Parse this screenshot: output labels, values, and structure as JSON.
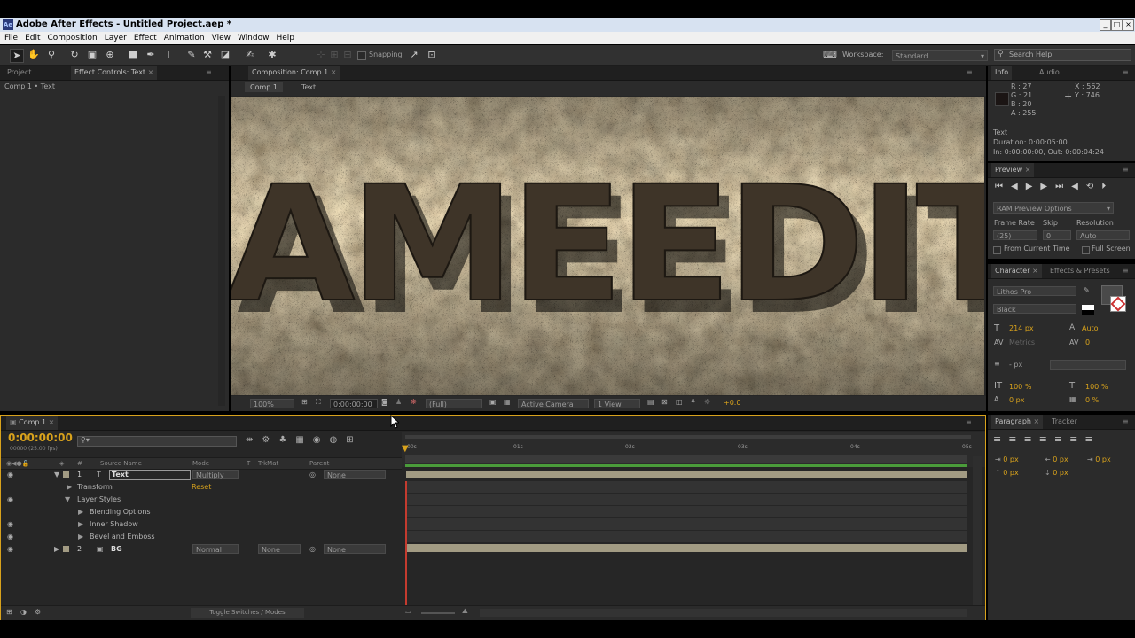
{
  "window": {
    "title": "Adobe After Effects - Untitled Project.aep *",
    "app_icon": "Ae",
    "min": "_",
    "max": "□",
    "close": "×"
  },
  "menu": [
    "File",
    "Edit",
    "Composition",
    "Layer",
    "Effect",
    "Animation",
    "View",
    "Window",
    "Help"
  ],
  "toolbar": {
    "snapping": "Snapping",
    "workspace_label": "Workspace:",
    "workspace_value": "Standard",
    "search_placeholder": "Search Help"
  },
  "project_panel": {
    "tab_project": "Project",
    "tab_effect_controls": "Effect Controls: Text",
    "breadcrumb": "Comp 1 • Text"
  },
  "composition": {
    "tab": "Composition: Comp 1",
    "breadcrumbs": [
      "Comp 1",
      "Text"
    ],
    "viewer_text": "AMEEDIT",
    "footer": {
      "zoom": "100%",
      "timecode": "0:00:00:00",
      "resolution": "(Full)",
      "camera": "Active Camera",
      "views": "1 View",
      "exposure": "+0.0"
    }
  },
  "info_panel": {
    "tabs": [
      "Info",
      "Audio"
    ],
    "r": "R : 27",
    "g": "G : 21",
    "b": "B : 20",
    "a": "A : 255",
    "x": "X : 562",
    "y": "Y : 746",
    "layer": "Text",
    "duration": "Duration: 0:00:05:00",
    "inout": "In: 0:00:00:00, Out: 0:00:04:24"
  },
  "preview_panel": {
    "tab": "Preview",
    "ram_options": "RAM Preview Options",
    "frame_rate_label": "Frame Rate",
    "skip_label": "Skip",
    "resolution_label": "Resolution",
    "frame_rate": "(25)",
    "skip": "0",
    "resolution": "Auto",
    "from_current": "From Current Time",
    "full_screen": "Full Screen"
  },
  "character_panel": {
    "tabs": [
      "Character",
      "Effects & Presets"
    ],
    "font": "Lithos Pro",
    "style": "Black",
    "size": "214 px",
    "leading": "Auto",
    "kerning": "Metrics",
    "tracking": "0",
    "stroke_width": "- px"
  },
  "paragraph_panel": {
    "tabs": [
      "Paragraph",
      "Tracker"
    ],
    "indents": [
      "0 px",
      "0 px",
      "0 px",
      "0 px",
      "0 px"
    ]
  },
  "timeline": {
    "tab": "Comp 1",
    "timecode": "0:00:00:00",
    "fps": "00000 (25.00 fps)",
    "columns": {
      "source": "Source Name",
      "mode": "Mode",
      "t": "T",
      "trkmat": "TrkMat",
      "parent": "Parent"
    },
    "ruler": [
      "00s",
      "01s",
      "02s",
      "03s",
      "04s",
      "05s"
    ],
    "layers": [
      {
        "num": "1",
        "name": "Text",
        "mode": "Multiply",
        "trkmat": "",
        "parent": "None"
      },
      {
        "num": "2",
        "name": "BG",
        "mode": "Normal",
        "trkmat": "None",
        "parent": "None"
      }
    ],
    "props": {
      "transform": "Transform",
      "reset": "Reset",
      "layer_styles": "Layer Styles",
      "blending": "Blending Options",
      "inner_shadow": "Inner Shadow",
      "bevel": "Bevel and Emboss"
    },
    "footer_toggle": "Toggle Switches / Modes"
  },
  "colors": {
    "accent_time": "#d8a21c",
    "work_area": "#4a9c3a",
    "layer_bar": "#a29b83",
    "playhead": "#c43b2f"
  }
}
